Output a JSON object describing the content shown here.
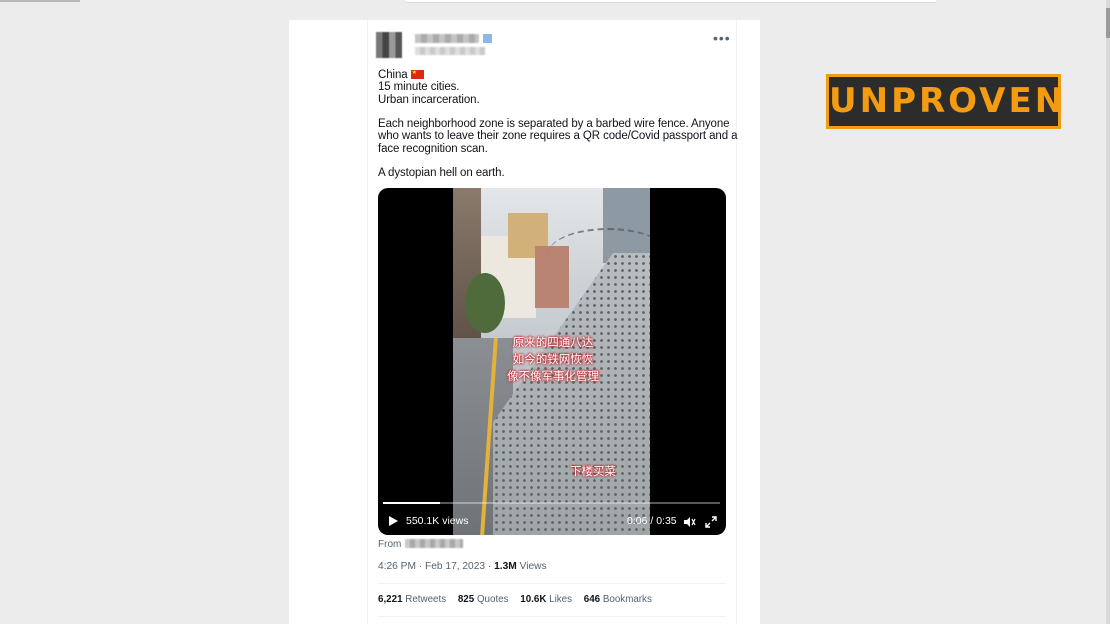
{
  "tweet": {
    "lines": [
      "China",
      "15 minute cities.",
      "Urban incarceration.",
      "",
      "Each neighborhood zone is separated by a barbed wire fence. Anyone",
      "who wants to leave their zone requires a QR code/Covid passport and a",
      "face recognition scan.",
      "",
      "A dystopian hell on earth."
    ]
  },
  "video": {
    "caption_lines": [
      "原来的四通八达",
      "如今的铁网恢恢",
      "像不像军事化管理"
    ],
    "caption_bottom": "下楼买菜",
    "views": "550.1K views",
    "time": "0:06 / 0:35",
    "progress": 0.17
  },
  "from_label": "From",
  "meta": {
    "time": "4:26 PM",
    "date": "Feb 17, 2023",
    "views_value": "1.3M",
    "views_label": "Views"
  },
  "stats": [
    {
      "value": "6,221",
      "label": "Retweets"
    },
    {
      "value": "825",
      "label": "Quotes"
    },
    {
      "value": "10.6K",
      "label": "Likes"
    },
    {
      "value": "646",
      "label": "Bookmarks"
    }
  ],
  "stamp": "UNPROVEN",
  "colors": {
    "stamp": "#f39c12",
    "stamp_bg": "#2c2c2c",
    "flag": "#de2910"
  }
}
